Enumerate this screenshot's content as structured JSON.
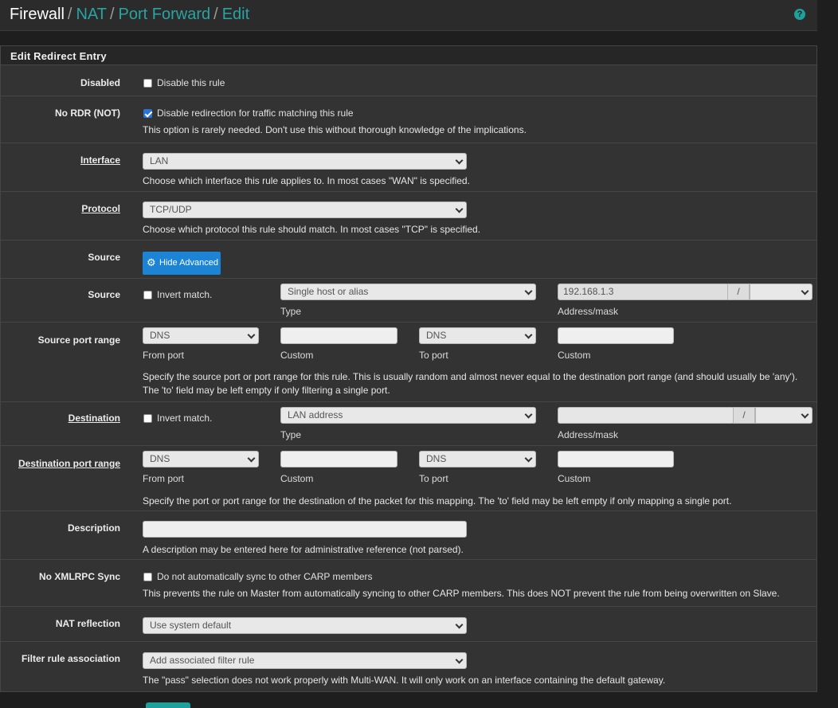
{
  "breadcrumb": {
    "first": "Firewall",
    "items": [
      "NAT",
      "Port Forward",
      "Edit"
    ]
  },
  "help_icon": "question-circle-icon",
  "panel_title": "Edit Redirect Entry",
  "disabled": {
    "label": "Disabled",
    "checkbox_label": "Disable this rule",
    "checked": false
  },
  "nordr": {
    "label": "No RDR (NOT)",
    "checkbox_label": "Disable redirection for traffic matching this rule",
    "checked": true,
    "help": "This option is rarely needed. Don't use this without thorough knowledge of the implications."
  },
  "interface": {
    "label": "Interface",
    "value": "LAN",
    "help": "Choose which interface this rule applies to. In most cases \"WAN\" is specified."
  },
  "protocol": {
    "label": "Protocol",
    "value": "TCP/UDP",
    "help": "Choose which protocol this rule should match. In most cases \"TCP\" is specified."
  },
  "source_adv": {
    "label": "Source",
    "button": "Hide Advanced",
    "icon": "gear-icon"
  },
  "source": {
    "label": "Source",
    "invert_label": "Invert match.",
    "type_value": "Single host or alias",
    "type_caption": "Type",
    "address": "192.168.1.3",
    "slash": "/",
    "mask": "",
    "address_caption": "Address/mask"
  },
  "source_port": {
    "label": "Source port range",
    "from_value": "DNS",
    "from_caption": "From port",
    "custom1_caption": "Custom",
    "to_value": "DNS",
    "to_caption": "To port",
    "custom2_caption": "Custom",
    "help": "Specify the source port or port range for this rule. This is usually random and almost never equal to the destination port range (and should usually be 'any'). The 'to' field may be left empty if only filtering a single port."
  },
  "destination": {
    "label": "Destination",
    "invert_label": "Invert match.",
    "type_value": "LAN address",
    "type_caption": "Type",
    "address": "",
    "slash": "/",
    "address_caption": "Address/mask"
  },
  "dest_port": {
    "label": "Destination port range",
    "from_value": "DNS",
    "from_caption": "From port",
    "custom1_caption": "Custom",
    "to_value": "DNS",
    "to_caption": "To port",
    "custom2_caption": "Custom",
    "help": "Specify the port or port range for the destination of the packet for this mapping. The 'to' field may be left empty if only mapping a single port."
  },
  "description": {
    "label": "Description",
    "value": "",
    "help": "A description may be entered here for administrative reference (not parsed)."
  },
  "xmlrpc": {
    "label": "No XMLRPC Sync",
    "checkbox_label": "Do not automatically sync to other CARP members",
    "checked": false,
    "help": "This prevents the rule on Master from automatically syncing to other CARP members. This does NOT prevent the rule from being overwritten on Slave."
  },
  "nat_reflection": {
    "label": "NAT reflection",
    "value": "Use system default"
  },
  "filter_assoc": {
    "label": "Filter rule association",
    "value": "Add associated filter rule",
    "help": "The \"pass\" selection does not work properly with Multi-WAN. It will only work on an interface containing the default gateway."
  },
  "colors": {
    "accent": "#1fa19b",
    "button_blue": "#1b84d4",
    "panel_bg": "#333333"
  }
}
